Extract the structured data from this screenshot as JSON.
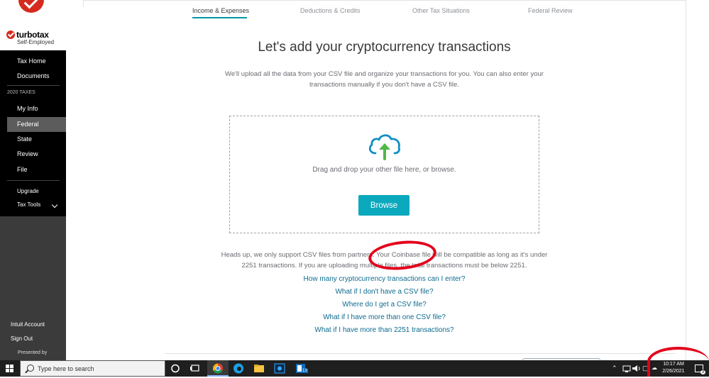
{
  "sidebar": {
    "brand_name": "turbotax",
    "brand_sub": "Self-Employed",
    "tax_home": "Tax Home",
    "documents": "Documents",
    "section_label": "2020 TAXES",
    "my_info": "My Info",
    "federal": "Federal",
    "state": "State",
    "review": "Review",
    "file": "File",
    "upgrade": "Upgrade",
    "tax_tools": "Tax Tools",
    "intuit_account": "Intuit Account",
    "sign_out": "Sign Out",
    "presented_by": "Presented by"
  },
  "tabs": {
    "income": "Income & Expenses",
    "deductions": "Deductions & Credits",
    "other": "Other Tax Situations",
    "review": "Federal Review"
  },
  "main": {
    "title": "Let's add your cryptocurrency transactions",
    "intro": "We'll upload all the data from your CSV file and organize your transactions for you. You can also enter your transactions manually if you don't have a CSV file.",
    "drop_text": "Drag and drop your other file here, or browse.",
    "browse_label": "Browse",
    "headsup_line1": "Heads up, we only support CSV files from partners. Your Coinbase file will be compatible as long as it's under",
    "headsup_line2": "2251 transactions. If you are uploading multiple files, the total transactions must be below 2251.",
    "faq": [
      "How many cryptocurrency transactions can I enter?",
      "What if I don't have a CSV file?",
      "Where do I get a CSV file?",
      "What if I have more than one CSV file?",
      "What if I have more than 2251 transactions?"
    ]
  },
  "taskbar": {
    "search_placeholder": "Type here to search",
    "time": "10:17 AM",
    "date": "2/26/2021",
    "badge_count": "13",
    "notification_count": "3"
  },
  "colors": {
    "accent": "#0098a6",
    "button": "#0ba9bd",
    "link": "#0d6b8f",
    "brand_red": "#d52b1e",
    "annotation_red": "#e3001b"
  }
}
